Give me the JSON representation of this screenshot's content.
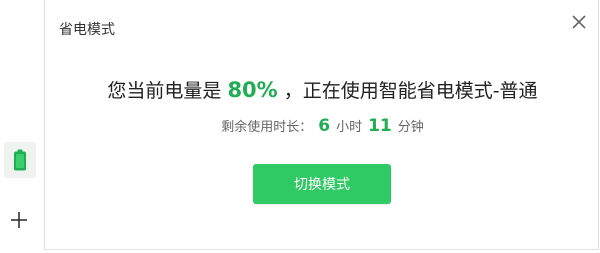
{
  "panel": {
    "title": "省电模式",
    "headline_prefix": "您当前电量是",
    "battery_percent": "80%",
    "headline_suffix": "，正在使用智能省电模式-普通",
    "remaining_prefix": "剩余使用时长：",
    "hours_value": "6",
    "hours_unit": "小时",
    "minutes_value": "11",
    "minutes_unit": "分钟",
    "switch_button_label": "切换模式"
  },
  "icons": {
    "close": "close-icon",
    "battery": "battery-icon",
    "add": "plus-icon"
  },
  "colors": {
    "accent_green": "#1fae54",
    "button_green": "#2fca63",
    "battery_tile_bg": "#eef3f0"
  }
}
